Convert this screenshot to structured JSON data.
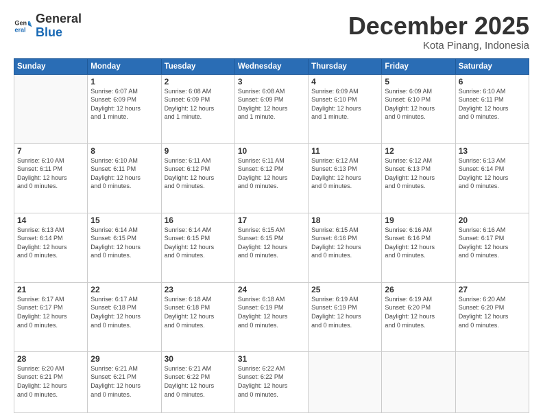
{
  "header": {
    "logo": {
      "general": "General",
      "blue": "Blue"
    },
    "title": "December 2025",
    "location": "Kota Pinang, Indonesia"
  },
  "days_header": [
    "Sunday",
    "Monday",
    "Tuesday",
    "Wednesday",
    "Thursday",
    "Friday",
    "Saturday"
  ],
  "weeks": [
    [
      {
        "day": "",
        "info": ""
      },
      {
        "day": "1",
        "info": "Sunrise: 6:07 AM\nSunset: 6:09 PM\nDaylight: 12 hours\nand 1 minute."
      },
      {
        "day": "2",
        "info": "Sunrise: 6:08 AM\nSunset: 6:09 PM\nDaylight: 12 hours\nand 1 minute."
      },
      {
        "day": "3",
        "info": "Sunrise: 6:08 AM\nSunset: 6:09 PM\nDaylight: 12 hours\nand 1 minute."
      },
      {
        "day": "4",
        "info": "Sunrise: 6:09 AM\nSunset: 6:10 PM\nDaylight: 12 hours\nand 1 minute."
      },
      {
        "day": "5",
        "info": "Sunrise: 6:09 AM\nSunset: 6:10 PM\nDaylight: 12 hours\nand 0 minutes."
      },
      {
        "day": "6",
        "info": "Sunrise: 6:10 AM\nSunset: 6:11 PM\nDaylight: 12 hours\nand 0 minutes."
      }
    ],
    [
      {
        "day": "7",
        "info": "Sunrise: 6:10 AM\nSunset: 6:11 PM\nDaylight: 12 hours\nand 0 minutes."
      },
      {
        "day": "8",
        "info": "Sunrise: 6:10 AM\nSunset: 6:11 PM\nDaylight: 12 hours\nand 0 minutes."
      },
      {
        "day": "9",
        "info": "Sunrise: 6:11 AM\nSunset: 6:12 PM\nDaylight: 12 hours\nand 0 minutes."
      },
      {
        "day": "10",
        "info": "Sunrise: 6:11 AM\nSunset: 6:12 PM\nDaylight: 12 hours\nand 0 minutes."
      },
      {
        "day": "11",
        "info": "Sunrise: 6:12 AM\nSunset: 6:13 PM\nDaylight: 12 hours\nand 0 minutes."
      },
      {
        "day": "12",
        "info": "Sunrise: 6:12 AM\nSunset: 6:13 PM\nDaylight: 12 hours\nand 0 minutes."
      },
      {
        "day": "13",
        "info": "Sunrise: 6:13 AM\nSunset: 6:14 PM\nDaylight: 12 hours\nand 0 minutes."
      }
    ],
    [
      {
        "day": "14",
        "info": "Sunrise: 6:13 AM\nSunset: 6:14 PM\nDaylight: 12 hours\nand 0 minutes."
      },
      {
        "day": "15",
        "info": "Sunrise: 6:14 AM\nSunset: 6:15 PM\nDaylight: 12 hours\nand 0 minutes."
      },
      {
        "day": "16",
        "info": "Sunrise: 6:14 AM\nSunset: 6:15 PM\nDaylight: 12 hours\nand 0 minutes."
      },
      {
        "day": "17",
        "info": "Sunrise: 6:15 AM\nSunset: 6:15 PM\nDaylight: 12 hours\nand 0 minutes."
      },
      {
        "day": "18",
        "info": "Sunrise: 6:15 AM\nSunset: 6:16 PM\nDaylight: 12 hours\nand 0 minutes."
      },
      {
        "day": "19",
        "info": "Sunrise: 6:16 AM\nSunset: 6:16 PM\nDaylight: 12 hours\nand 0 minutes."
      },
      {
        "day": "20",
        "info": "Sunrise: 6:16 AM\nSunset: 6:17 PM\nDaylight: 12 hours\nand 0 minutes."
      }
    ],
    [
      {
        "day": "21",
        "info": "Sunrise: 6:17 AM\nSunset: 6:17 PM\nDaylight: 12 hours\nand 0 minutes."
      },
      {
        "day": "22",
        "info": "Sunrise: 6:17 AM\nSunset: 6:18 PM\nDaylight: 12 hours\nand 0 minutes."
      },
      {
        "day": "23",
        "info": "Sunrise: 6:18 AM\nSunset: 6:18 PM\nDaylight: 12 hours\nand 0 minutes."
      },
      {
        "day": "24",
        "info": "Sunrise: 6:18 AM\nSunset: 6:19 PM\nDaylight: 12 hours\nand 0 minutes."
      },
      {
        "day": "25",
        "info": "Sunrise: 6:19 AM\nSunset: 6:19 PM\nDaylight: 12 hours\nand 0 minutes."
      },
      {
        "day": "26",
        "info": "Sunrise: 6:19 AM\nSunset: 6:20 PM\nDaylight: 12 hours\nand 0 minutes."
      },
      {
        "day": "27",
        "info": "Sunrise: 6:20 AM\nSunset: 6:20 PM\nDaylight: 12 hours\nand 0 minutes."
      }
    ],
    [
      {
        "day": "28",
        "info": "Sunrise: 6:20 AM\nSunset: 6:21 PM\nDaylight: 12 hours\nand 0 minutes."
      },
      {
        "day": "29",
        "info": "Sunrise: 6:21 AM\nSunset: 6:21 PM\nDaylight: 12 hours\nand 0 minutes."
      },
      {
        "day": "30",
        "info": "Sunrise: 6:21 AM\nSunset: 6:22 PM\nDaylight: 12 hours\nand 0 minutes."
      },
      {
        "day": "31",
        "info": "Sunrise: 6:22 AM\nSunset: 6:22 PM\nDaylight: 12 hours\nand 0 minutes."
      },
      {
        "day": "",
        "info": ""
      },
      {
        "day": "",
        "info": ""
      },
      {
        "day": "",
        "info": ""
      }
    ]
  ]
}
